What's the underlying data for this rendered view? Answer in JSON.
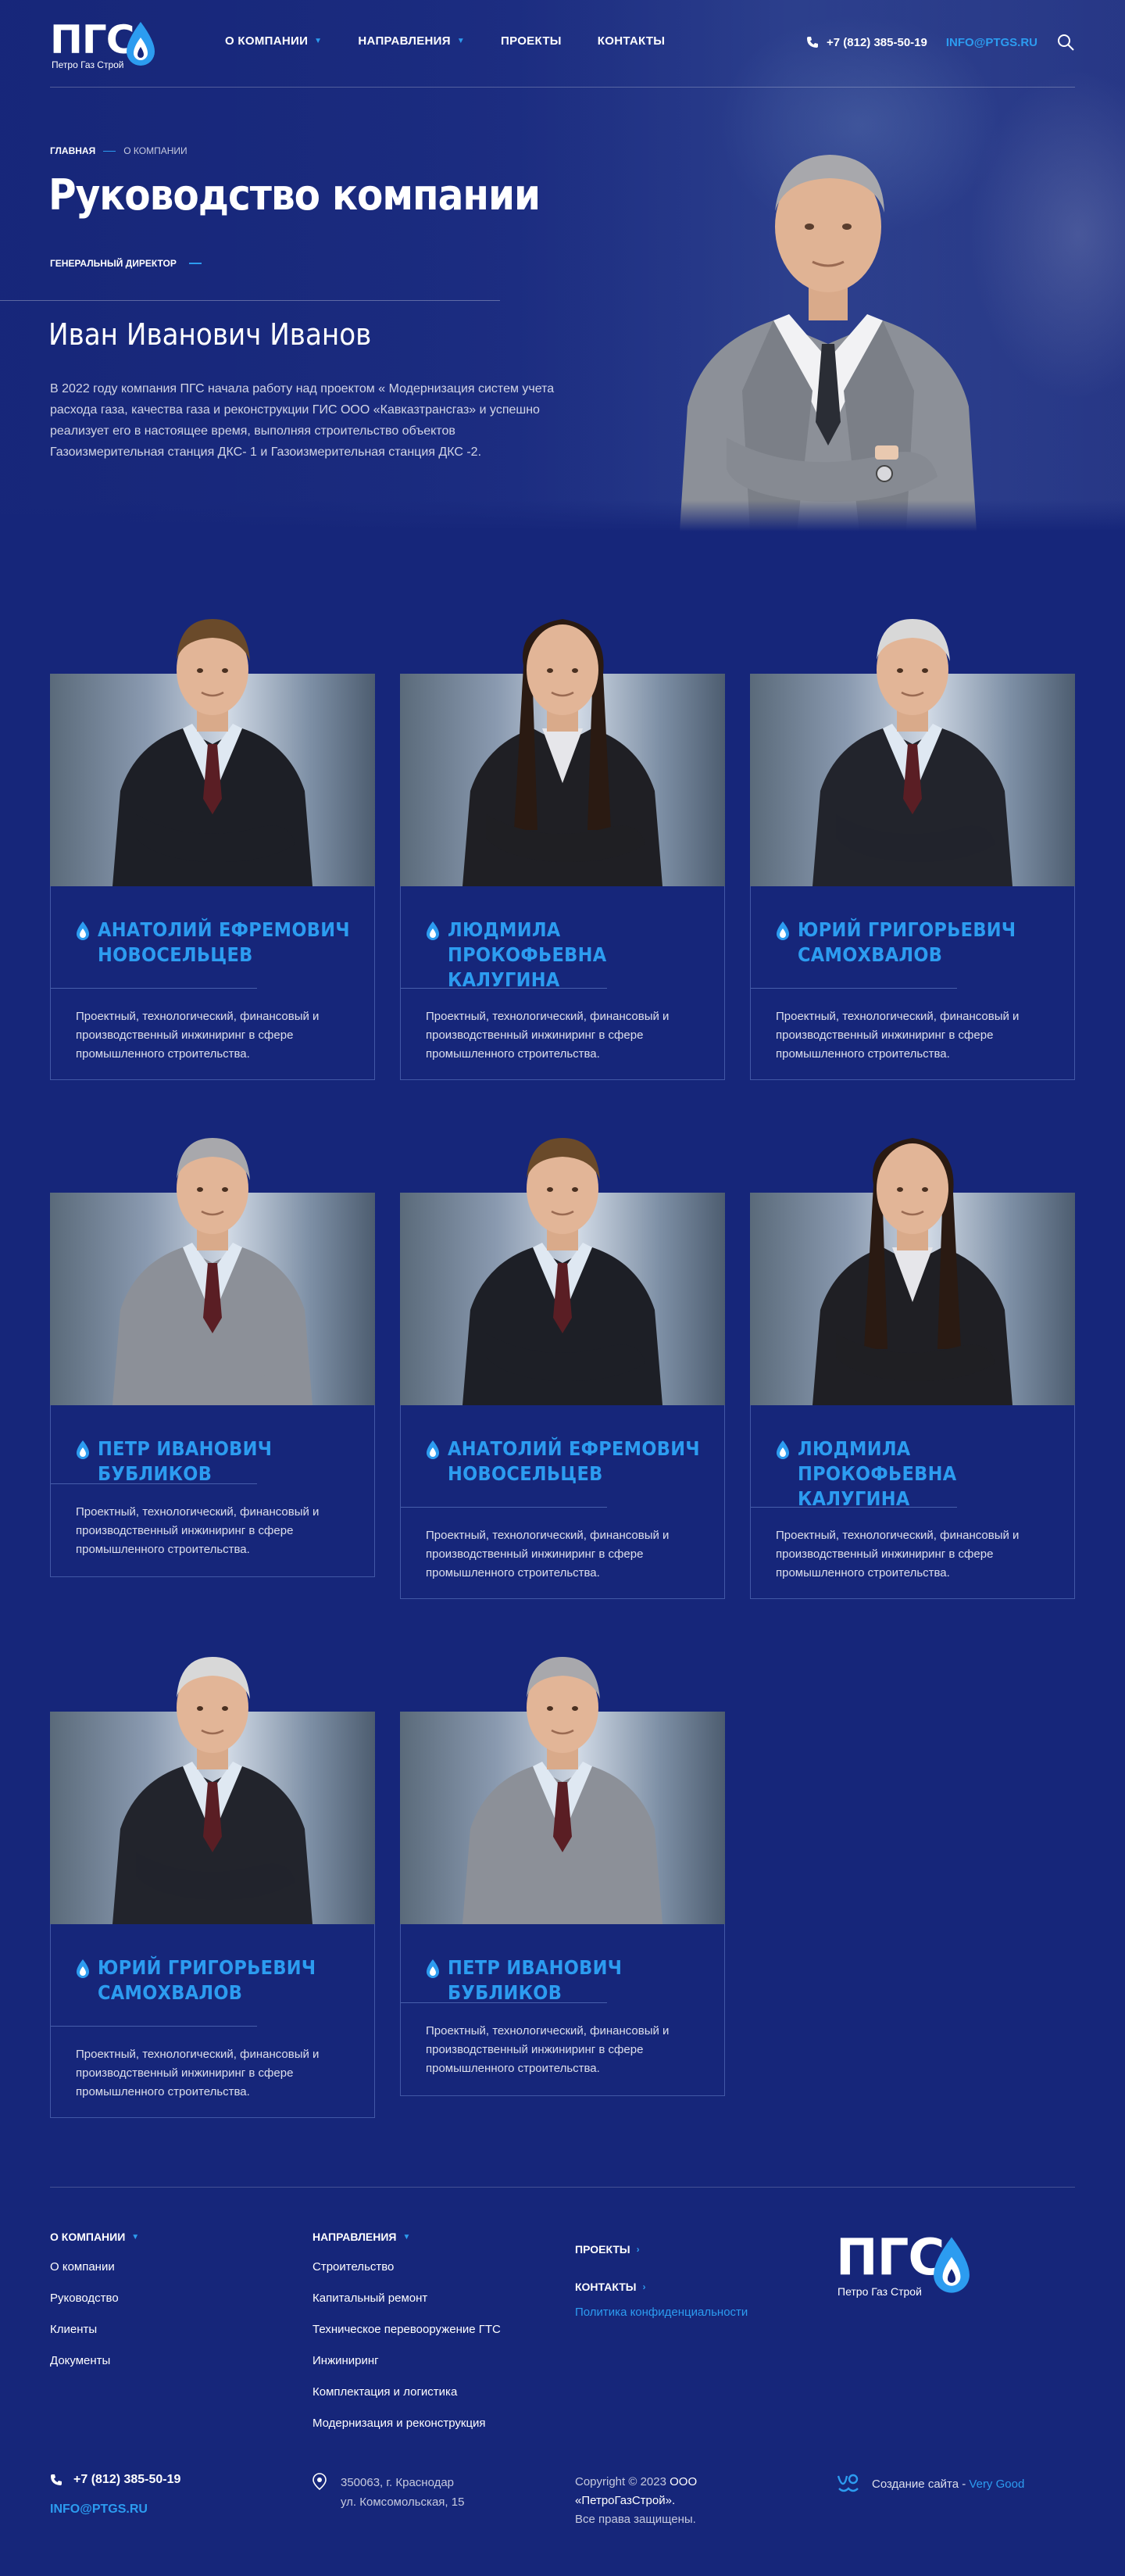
{
  "header": {
    "logo_letters": "ПГС",
    "logo_sub": "Петро Газ Строй",
    "nav": [
      {
        "label": "О компании",
        "chevron": true
      },
      {
        "label": "Направления",
        "chevron": true
      },
      {
        "label": "Проекты",
        "chevron": false
      },
      {
        "label": "Контакты",
        "chevron": false
      }
    ],
    "phone": "+7 (812) 385-50-19",
    "email": "INFO@PTGS.RU"
  },
  "breadcrumb": {
    "home": "Главная",
    "current": "О компании"
  },
  "page_title": "Руководство компании",
  "director": {
    "role": "Генеральный директор",
    "name": "Иван Иванович Иванов",
    "text": "В 2022 году компания ПГС начала работу над проектом « Модернизация систем учета расхода газа, качества газа и реконструкции ГИС ООО «Кавказтрансгаз» и успешно реализует его в настоящее время, выполняя строительство объектов Газоизмерительная станция ДКС- 1 и Газоизмерительная станция ДКС -2."
  },
  "team": [
    {
      "name": "Анатолий Ефремович Новосельцев",
      "desc": "Проектный, технологический, финансовый и производственный инжиниринг в сфере промышленного строительства.",
      "look": "dark"
    },
    {
      "name": "Людмила Прокофьевна Калугина",
      "desc": "Проектный, технологический, финансовый и производственный инжиниринг в сфере промышленного строительства.",
      "look": "woman"
    },
    {
      "name": "Юрий Григорьевич Самохвалов",
      "desc": "Проектный, технологический, финансовый и производственный инжиниринг в сфере промышленного строительства.",
      "look": "senior"
    },
    {
      "name": "Петр Иванович Бубликов",
      "desc": "Проектный, технологический, финансовый и производственный инжиниринг в сфере промышленного строительства.",
      "look": "grey"
    },
    {
      "name": "Анатолий Ефремович Новосельцев",
      "desc": "Проектный, технологический, финансовый и производственный инжиниринг в сфере промышленного строительства.",
      "look": "dark"
    },
    {
      "name": "Людмила Прокофьевна Калугина",
      "desc": "Проектный, технологический, финансовый и производственный инжиниринг в сфере промышленного строительства.",
      "look": "woman"
    },
    {
      "name": "Юрий Григорьевич Самохвалов",
      "desc": "Проектный, технологический, финансовый и производственный инжиниринг в сфере промышленного строительства.",
      "look": "senior"
    },
    {
      "name": "Петр Иванович Бубликов",
      "desc": "Проектный, технологический, финансовый и производственный инжиниринг в сфере промышленного строительства.",
      "look": "grey"
    }
  ],
  "footer": {
    "about": {
      "head": "О компании",
      "links": [
        "О компании",
        "Руководство",
        "Клиенты",
        "Документы"
      ]
    },
    "directions": {
      "head": "Направления",
      "links": [
        "Строительство",
        "Капитальный ремонт",
        "Техническое перевооружение ГТС",
        "Инжиниринг",
        "Комплектация и логистика",
        "Модернизация и реконструкция"
      ]
    },
    "projects": "Проекты",
    "contacts": "Контакты",
    "policy": "Политика конфиденциальности",
    "phone": "+7 (812) 385-50-19",
    "email": "INFO@PTGS.RU",
    "address_line1": "350063, г. Краснодар",
    "address_line2": "ул. Комсомольская, 15",
    "copyright_prefix": "Copyright © 2023",
    "copyright_company": "ООО «ПетроГазСтрой».",
    "copyright_rights": "Все права защищены.",
    "made_by": "Создание сайта - ",
    "made_by_studio": "Very Good"
  },
  "colors": {
    "background": "#16267a",
    "accent": "#2c9cf0"
  }
}
